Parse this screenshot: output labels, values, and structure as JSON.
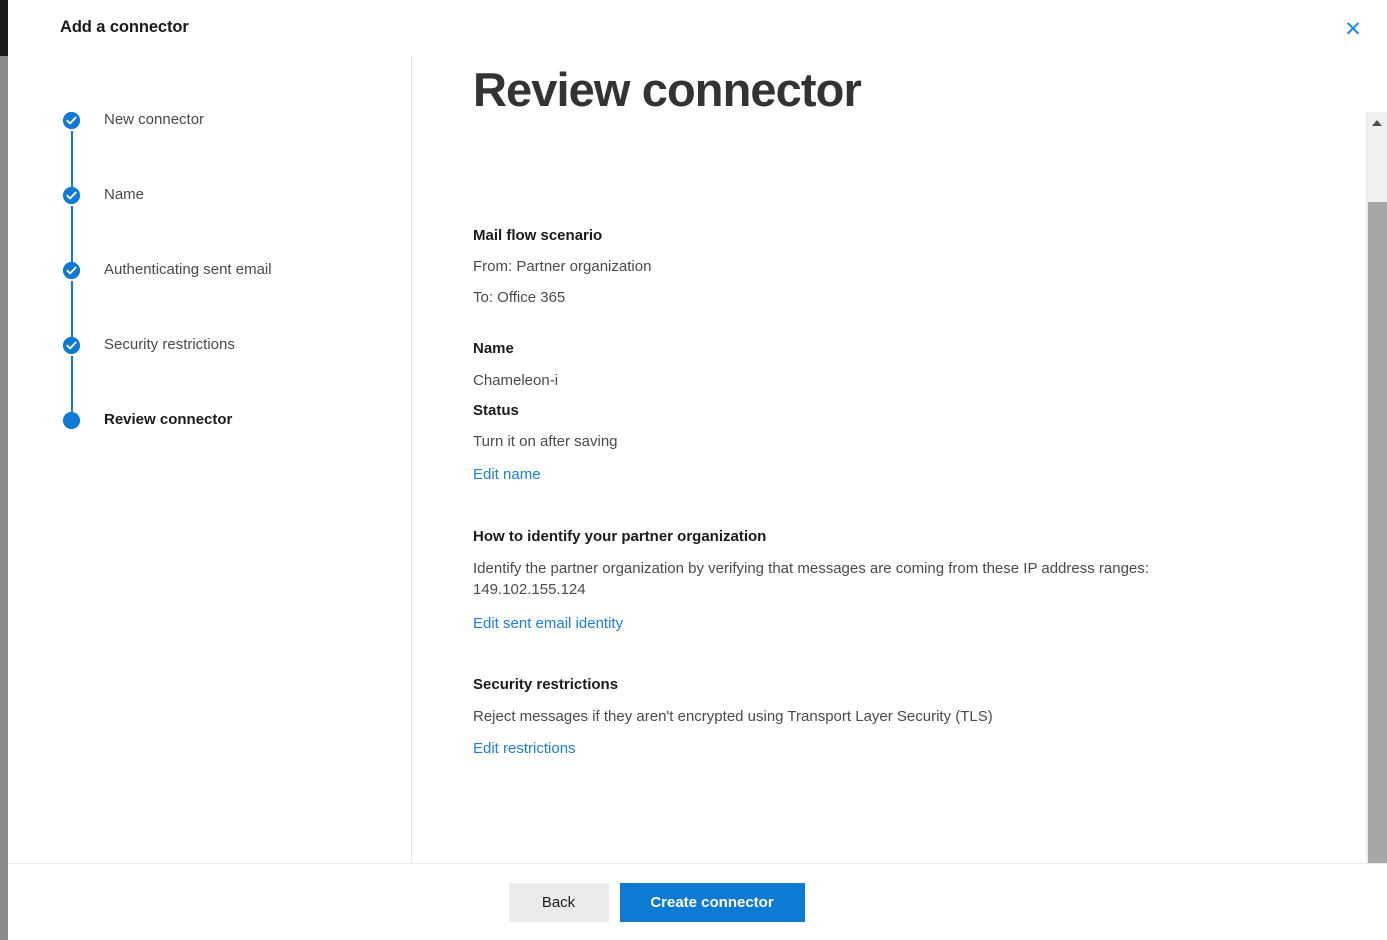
{
  "dialog": {
    "title": "Add a connector",
    "close_label": "✕"
  },
  "stepper": {
    "items": [
      {
        "label": "New connector",
        "state": "completed"
      },
      {
        "label": "Name",
        "state": "completed"
      },
      {
        "label": "Authenticating sent email",
        "state": "completed"
      },
      {
        "label": "Security restrictions",
        "state": "completed"
      },
      {
        "label": "Review connector",
        "state": "current"
      }
    ]
  },
  "main": {
    "heading": "Review connector",
    "sections": {
      "mail_flow": {
        "title": "Mail flow scenario",
        "from": "From: Partner organization",
        "to": "To: Office 365"
      },
      "name": {
        "title": "Name",
        "value": "Chameleon-i"
      },
      "status": {
        "title": "Status",
        "value": "Turn it on after saving",
        "edit_link": "Edit name"
      },
      "identify": {
        "title": "How to identify your partner organization",
        "value": "Identify the partner organization by verifying that messages are coming from these IP address ranges: 149.102.155.124",
        "edit_link": "Edit sent email identity"
      },
      "security": {
        "title": "Security restrictions",
        "value": "Reject messages if they aren't encrypted using Transport Layer Security (TLS)",
        "edit_link": "Edit restrictions"
      }
    }
  },
  "footer": {
    "back_label": "Back",
    "create_label": "Create connector"
  },
  "colors": {
    "accent": "#0f7ad4",
    "link": "#1b7fd4",
    "heading": "#333333",
    "body_text": "#4a4a4a",
    "secondary_button": "#ebebeb"
  }
}
